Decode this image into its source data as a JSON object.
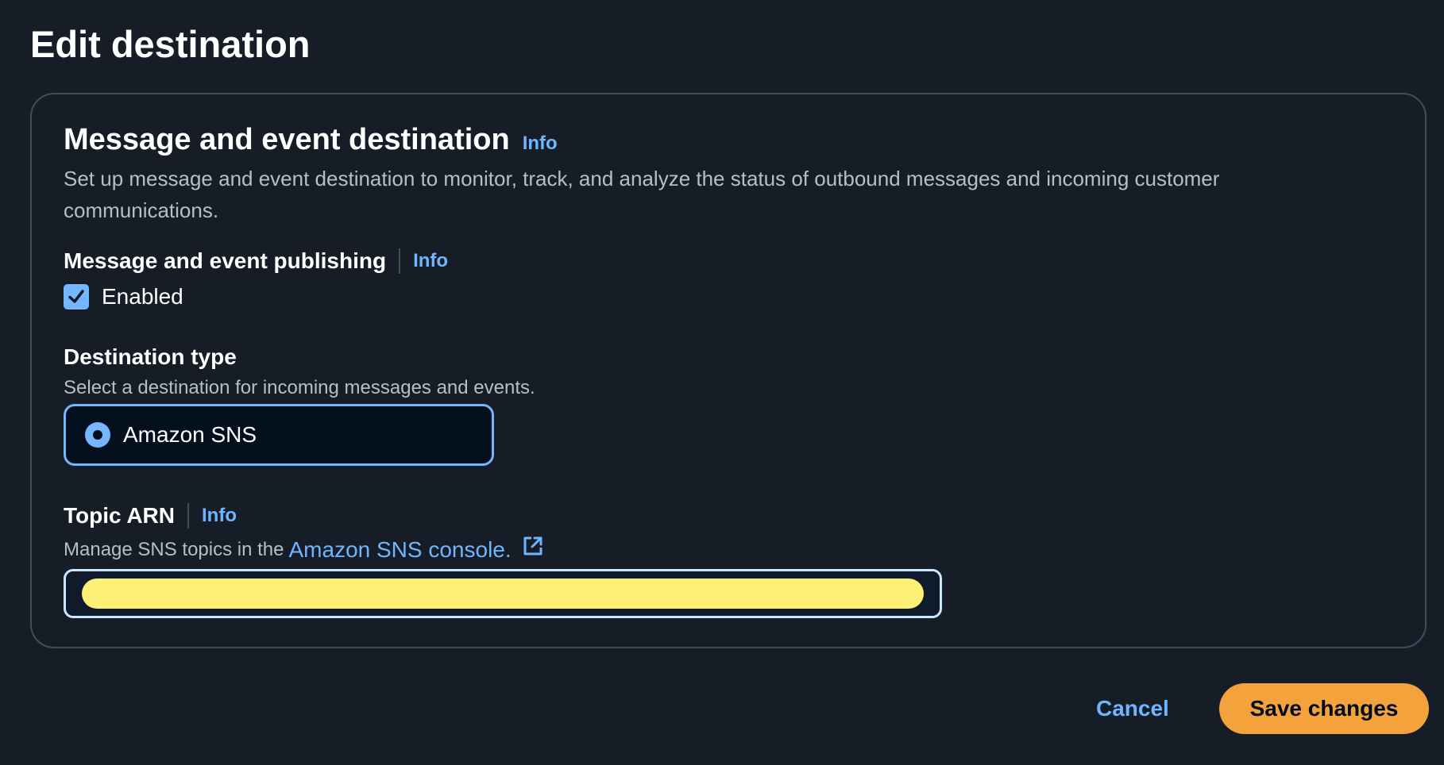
{
  "page": {
    "title": "Edit destination"
  },
  "panel": {
    "title": "Message and event destination",
    "info_label": "Info",
    "description": "Set up message and event destination to monitor, track, and analyze the status of outbound messages and incoming customer communications."
  },
  "publishing": {
    "label": "Message and event publishing",
    "info_label": "Info",
    "checkbox_label": "Enabled",
    "checked": true
  },
  "destination_type": {
    "label": "Destination type",
    "description": "Select a destination for incoming messages and events.",
    "selected_option": "Amazon SNS"
  },
  "topic_arn": {
    "label": "Topic ARN",
    "info_label": "Info",
    "description_prefix": "Manage SNS topics in the",
    "console_link": "Amazon SNS console.",
    "value_redacted": true
  },
  "actions": {
    "cancel_label": "Cancel",
    "save_label": "Save changes"
  },
  "icons": {
    "checkbox": "checkmark-icon",
    "external_link": "external-link-icon",
    "radio": "radio-selected-icon"
  },
  "colors": {
    "background": "#161d26",
    "link": "#6eb6ff",
    "accent": "#75b7ff",
    "primary_button": "#f4a23c",
    "redaction": "#fdf175"
  }
}
